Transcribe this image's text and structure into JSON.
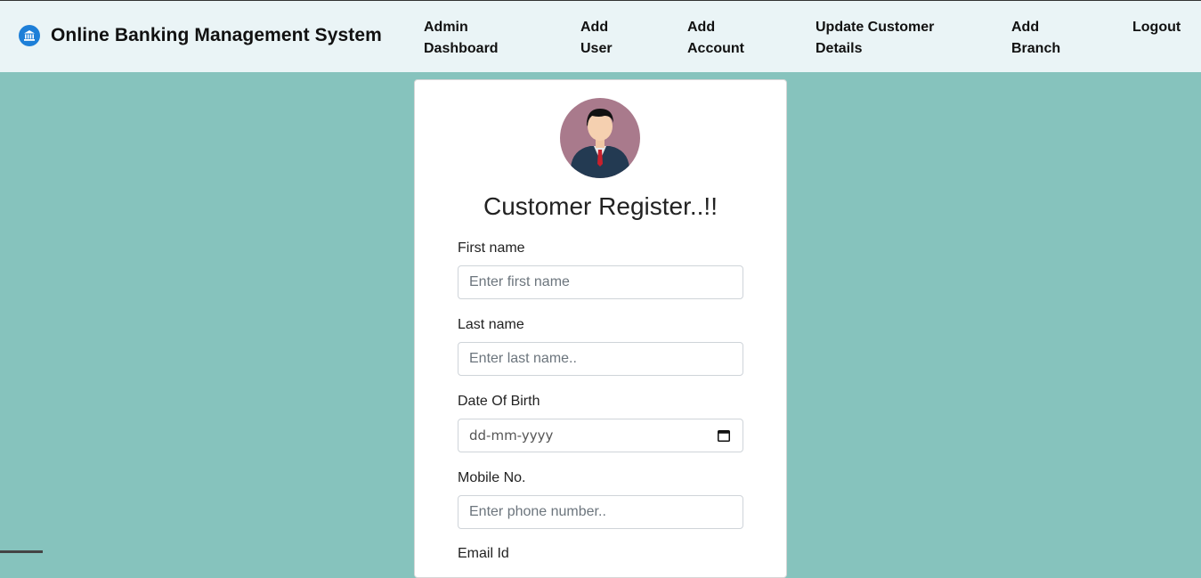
{
  "brand": {
    "title": "Online Banking Management System",
    "icon": "bank-icon",
    "icon_color": "#1d7fd8"
  },
  "nav": {
    "admin_dashboard": [
      "Admin",
      "Dashboard"
    ],
    "add_user": [
      "Add",
      "User"
    ],
    "add_account": [
      "Add",
      "Account"
    ],
    "update_customer": [
      "Update Customer",
      "Details"
    ],
    "add_branch": [
      "Add",
      "Branch"
    ],
    "logout": "Logout"
  },
  "form": {
    "title": "Customer Register..!!",
    "avatar_icon": "user-avatar-icon",
    "first_name": {
      "label": "First name",
      "placeholder": "Enter first name",
      "value": ""
    },
    "last_name": {
      "label": "Last name",
      "placeholder": "Enter last name..",
      "value": ""
    },
    "dob": {
      "label": "Date Of Birth",
      "placeholder": "dd-mm-yyyy"
    },
    "mobile": {
      "label": "Mobile No.",
      "placeholder": "Enter phone number..",
      "value": ""
    },
    "email": {
      "label": "Email Id"
    }
  },
  "colors": {
    "page_background": "#86c3bd",
    "navbar_background": "#eaf4f6",
    "avatar_background": "#a97a8c"
  }
}
